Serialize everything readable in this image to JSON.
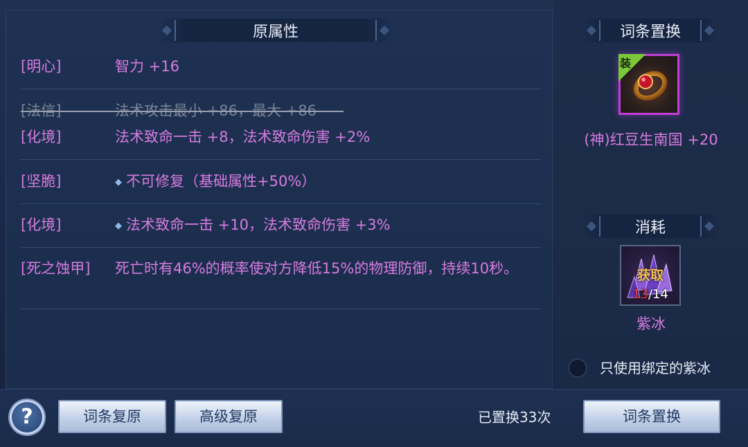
{
  "original_attrs": {
    "title": "原属性",
    "rows": [
      {
        "tag": "[明心]",
        "value": "智力 +16"
      },
      {
        "tag": "[法信]",
        "value": "法术攻击最小 +86，最大 +86"
      },
      {
        "tag": "[化境]",
        "value": "法术致命一击 +8，法术致命伤害 +2%"
      },
      {
        "tag": "[坚脆]",
        "value": "不可修复（基础属性+50%）"
      },
      {
        "tag": "[化境]",
        "value": "法术致命一击 +10，法术致命伤害 +3%"
      },
      {
        "tag": "[死之蚀甲]",
        "value": "死亡时有46%的概率使对方降低15%的物理防御，持续10秒。"
      }
    ]
  },
  "replace_panel": {
    "title": "词条置换",
    "equip_badge": "装",
    "item_name": "(神)红豆生南国 +20"
  },
  "consume_panel": {
    "title": "消耗",
    "obtain_label": "获取",
    "have_count": "13",
    "need_count": "/14",
    "material_name": "紫冰",
    "bound_only_label": "只使用绑定的紫冰"
  },
  "bottom": {
    "help_label": "?",
    "restore_label": "词条复原",
    "advanced_restore_label": "高级复原",
    "replace_count_text": "已置换33次",
    "replace_button_label": "词条置换"
  },
  "colors": {
    "attr_text": "#d77be0",
    "struck_text": "#7b8496",
    "item_border": "#c23fd6",
    "have_count": "#e03a3a",
    "obtain_text": "#f3c24a"
  },
  "icons": {
    "item": "ring-icon",
    "material": "crystal-icon",
    "gem_bullet": "diamond-bullet-icon"
  }
}
